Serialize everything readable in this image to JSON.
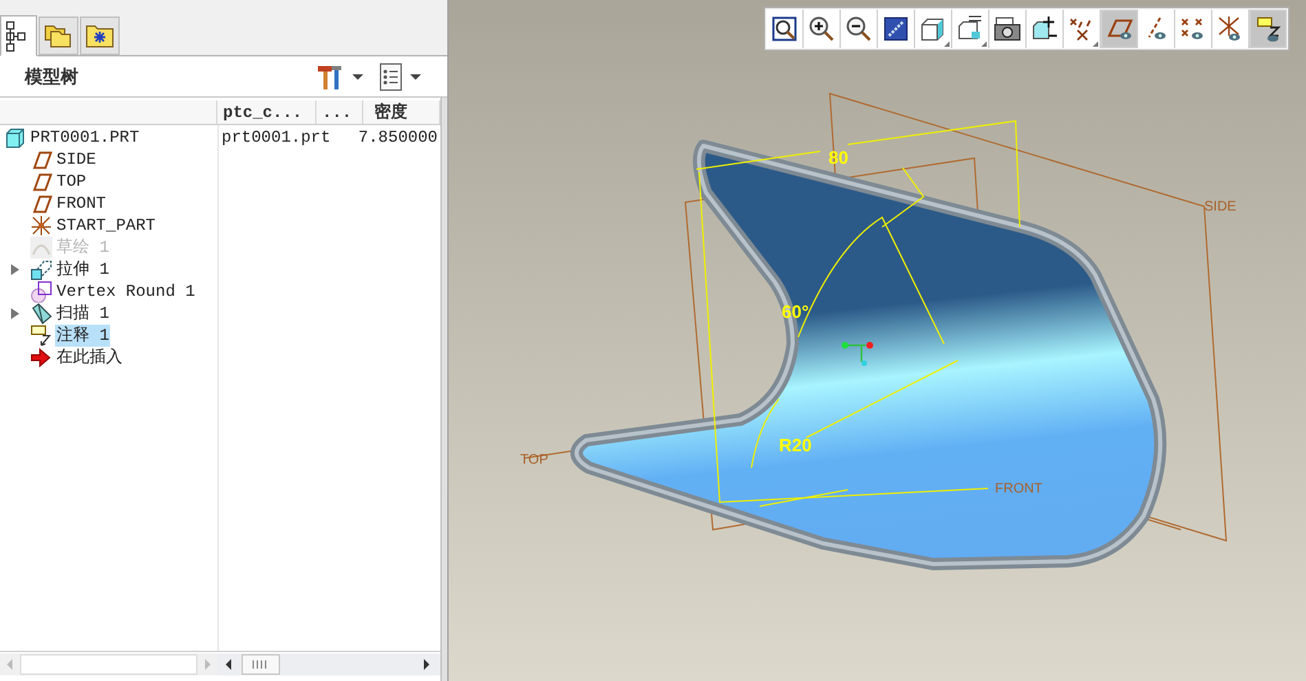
{
  "panel_tabs": [
    {
      "kind": "tree",
      "selected": true
    },
    {
      "kind": "folders",
      "selected": false
    },
    {
      "kind": "favorites",
      "selected": false
    }
  ],
  "panel_title": "模型树",
  "tree_columns": [
    "ptc_c...",
    "...",
    "密度"
  ],
  "tree": {
    "label": "PRT0001.PRT",
    "kind": "part",
    "cells": [
      "prt0001.prt",
      "7.850000"
    ],
    "children": [
      {
        "label": "SIDE",
        "kind": "plane",
        "selected": false,
        "disabled": false
      },
      {
        "label": "TOP",
        "kind": "plane",
        "selected": false,
        "disabled": false
      },
      {
        "label": "FRONT",
        "kind": "plane",
        "selected": false,
        "disabled": false
      },
      {
        "label": "START_PART",
        "kind": "csys",
        "selected": false,
        "disabled": false
      },
      {
        "label": "草绘 1",
        "kind": "sketch",
        "selected": false,
        "disabled": true
      },
      {
        "label": "拉伸 1",
        "kind": "extrude",
        "selected": false,
        "disabled": false,
        "expanded": false
      },
      {
        "label": "Vertex Round 1",
        "kind": "round",
        "selected": false,
        "disabled": false
      },
      {
        "label": "扫描 1",
        "kind": "sweep",
        "selected": false,
        "disabled": false,
        "expanded": false
      },
      {
        "label": "注释 1",
        "kind": "note",
        "selected": true,
        "disabled": false
      },
      {
        "label": "在此插入",
        "kind": "insert",
        "selected": false,
        "disabled": false
      }
    ]
  },
  "view_toolbar": [
    {
      "kind": "refit",
      "pressed": false,
      "menu": false
    },
    {
      "kind": "zoom-in",
      "pressed": false,
      "menu": false
    },
    {
      "kind": "zoom-out",
      "pressed": false,
      "menu": false
    },
    {
      "kind": "repaint",
      "pressed": false,
      "menu": false
    },
    {
      "kind": "shading",
      "pressed": false,
      "menu": true
    },
    {
      "kind": "views",
      "pressed": false,
      "menu": true
    },
    {
      "kind": "camera",
      "pressed": false,
      "menu": false
    },
    {
      "kind": "orient",
      "pressed": false,
      "menu": false
    },
    {
      "kind": "datums",
      "pressed": false,
      "menu": true
    },
    {
      "kind": "planes",
      "pressed": true,
      "menu": false
    },
    {
      "kind": "axes",
      "pressed": false,
      "menu": false
    },
    {
      "kind": "points",
      "pressed": false,
      "menu": false
    },
    {
      "kind": "csys",
      "pressed": false,
      "menu": false
    },
    {
      "kind": "notes",
      "pressed": true,
      "menu": false
    }
  ],
  "viewport_labels": [
    {
      "kind": "dimension",
      "text": "80"
    },
    {
      "kind": "dimension",
      "text": "60°"
    },
    {
      "kind": "dimension",
      "text": "R20"
    },
    {
      "kind": "datum",
      "text": "SIDE"
    },
    {
      "kind": "datum",
      "text": "TOP"
    },
    {
      "kind": "datum",
      "text": "FRONT"
    }
  ]
}
